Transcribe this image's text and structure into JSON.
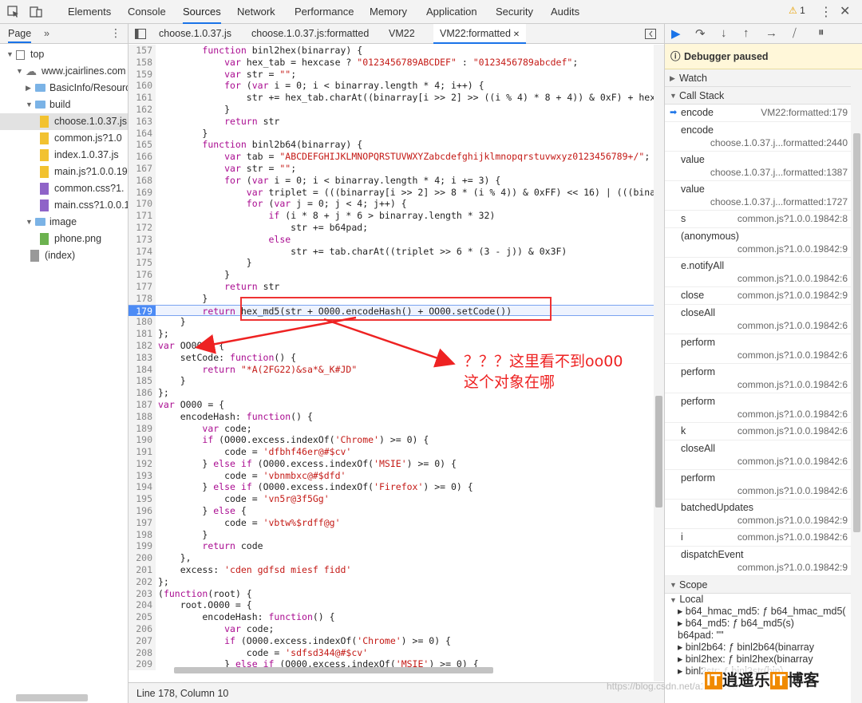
{
  "devtools": {
    "tabs": [
      "Elements",
      "Console",
      "Sources",
      "Network",
      "Performance",
      "Memory",
      "Application",
      "Security",
      "Audits"
    ],
    "active_tab": "Sources",
    "warning_count": "1"
  },
  "navigator": {
    "title": "Page",
    "tree": [
      {
        "label": "top",
        "indent": 0,
        "kind": "frame",
        "open": true
      },
      {
        "label": "www.jcairlines.com",
        "indent": 1,
        "kind": "cloud",
        "open": true
      },
      {
        "label": "BasicInfo/Resourc",
        "indent": 2,
        "kind": "folder",
        "open": false
      },
      {
        "label": "build",
        "indent": 2,
        "kind": "folder",
        "open": true
      },
      {
        "label": "choose.1.0.37.js",
        "indent": 3,
        "kind": "js",
        "selected": true
      },
      {
        "label": "common.js?1.0",
        "indent": 3,
        "kind": "js"
      },
      {
        "label": "index.1.0.37.js",
        "indent": 3,
        "kind": "js"
      },
      {
        "label": "main.js?1.0.0.19",
        "indent": 3,
        "kind": "js"
      },
      {
        "label": "common.css?1.",
        "indent": 3,
        "kind": "css"
      },
      {
        "label": "main.css?1.0.0.1",
        "indent": 3,
        "kind": "css"
      },
      {
        "label": "image",
        "indent": 2,
        "kind": "folder",
        "open": true
      },
      {
        "label": "phone.png",
        "indent": 3,
        "kind": "img"
      },
      {
        "label": "(index)",
        "indent": 2,
        "kind": "doc"
      }
    ]
  },
  "editor": {
    "tabs": [
      {
        "label": "choose.1.0.37.js",
        "active": false
      },
      {
        "label": "choose.1.0.37.js:formatted",
        "active": false
      },
      {
        "label": "VM22",
        "active": false
      },
      {
        "label": "VM22:formatted",
        "active": true
      }
    ],
    "current_line": 179,
    "status": "Line 178, Column 10",
    "lines": [
      {
        "n": 157,
        "t": "        function binl2hex(binarray) {"
      },
      {
        "n": 158,
        "t": "            var hex_tab = hexcase ? \"0123456789ABCDEF\" : \"0123456789abcdef\";"
      },
      {
        "n": 159,
        "t": "            var str = \"\";"
      },
      {
        "n": 160,
        "t": "            for (var i = 0; i < binarray.length * 4; i++) {"
      },
      {
        "n": 161,
        "t": "                str += hex_tab.charAt((binarray[i >> 2] >> ((i % 4) * 8 + 4)) & 0xF) + hex"
      },
      {
        "n": 162,
        "t": "            }"
      },
      {
        "n": 163,
        "t": "            return str"
      },
      {
        "n": 164,
        "t": "        }"
      },
      {
        "n": 165,
        "t": "        function binl2b64(binarray) {"
      },
      {
        "n": 166,
        "t": "            var tab = \"ABCDEFGHIJKLMNOPQRSTUVWXYZabcdefghijklmnopqrstuvwxyz0123456789+/\";"
      },
      {
        "n": 167,
        "t": "            var str = \"\";"
      },
      {
        "n": 168,
        "t": "            for (var i = 0; i < binarray.length * 4; i += 3) {"
      },
      {
        "n": 169,
        "t": "                var triplet = (((binarray[i >> 2] >> 8 * (i % 4)) & 0xFF) << 16) | (((bina"
      },
      {
        "n": 170,
        "t": "                for (var j = 0; j < 4; j++) {"
      },
      {
        "n": 171,
        "t": "                    if (i * 8 + j * 6 > binarray.length * 32)"
      },
      {
        "n": 172,
        "t": "                        str += b64pad;"
      },
      {
        "n": 173,
        "t": "                    else"
      },
      {
        "n": 174,
        "t": "                        str += tab.charAt((triplet >> 6 * (3 - j)) & 0x3F)"
      },
      {
        "n": 175,
        "t": "                }"
      },
      {
        "n": 176,
        "t": "            }"
      },
      {
        "n": 177,
        "t": "            return str"
      },
      {
        "n": 178,
        "t": "        }"
      },
      {
        "n": 179,
        "t": "        return hex_md5(str + O000.encodeHash() + OO00.setCode())"
      },
      {
        "n": 180,
        "t": "    }"
      },
      {
        "n": 181,
        "t": "};"
      },
      {
        "n": 182,
        "t": "var OO00 = {"
      },
      {
        "n": 183,
        "t": "    setCode: function() {"
      },
      {
        "n": 184,
        "t": "        return \"*A(2FG22)&sa*&_K#JD\""
      },
      {
        "n": 185,
        "t": "    }"
      },
      {
        "n": 186,
        "t": "};"
      },
      {
        "n": 187,
        "t": "var O000 = {"
      },
      {
        "n": 188,
        "t": "    encodeHash: function() {"
      },
      {
        "n": 189,
        "t": "        var code;"
      },
      {
        "n": 190,
        "t": "        if (O000.excess.indexOf('Chrome') >= 0) {"
      },
      {
        "n": 191,
        "t": "            code = 'dfbhf46er@#$cv'"
      },
      {
        "n": 192,
        "t": "        } else if (O000.excess.indexOf('MSIE') >= 0) {"
      },
      {
        "n": 193,
        "t": "            code = 'vbnmbxc@#$dfd'"
      },
      {
        "n": 194,
        "t": "        } else if (O000.excess.indexOf('Firefox') >= 0) {"
      },
      {
        "n": 195,
        "t": "            code = 'vn5r@3f5Gg'"
      },
      {
        "n": 196,
        "t": "        } else {"
      },
      {
        "n": 197,
        "t": "            code = 'vbtw%$rdff@g'"
      },
      {
        "n": 198,
        "t": "        }"
      },
      {
        "n": 199,
        "t": "        return code"
      },
      {
        "n": 200,
        "t": "    },"
      },
      {
        "n": 201,
        "t": "    excess: 'cden gdfsd miesf fidd'"
      },
      {
        "n": 202,
        "t": "};"
      },
      {
        "n": 203,
        "t": "(function(root) {"
      },
      {
        "n": 204,
        "t": "    root.O000 = {"
      },
      {
        "n": 205,
        "t": "        encodeHash: function() {"
      },
      {
        "n": 206,
        "t": "            var code;"
      },
      {
        "n": 207,
        "t": "            if (O000.excess.indexOf('Chrome') >= 0) {"
      },
      {
        "n": 208,
        "t": "                code = 'sdfsd344@#$cv'"
      },
      {
        "n": 209,
        "t": "            } else if (O000.excess.indexOf('MSIE') >= 0) {"
      }
    ]
  },
  "annotation": {
    "line1": "？？？这里看不到oo00",
    "line2": "这个对象在哪"
  },
  "debugger": {
    "paused_label": "Debugger paused",
    "watch_label": "Watch",
    "callstack_label": "Call Stack",
    "frames": [
      {
        "name": "encode",
        "loc": "VM22:formatted:179",
        "current": true
      },
      {
        "name": "encode",
        "loc": "choose.1.0.37.j...formatted:2440"
      },
      {
        "name": "value",
        "loc": "choose.1.0.37.j...formatted:1387"
      },
      {
        "name": "value",
        "loc": "choose.1.0.37.j...formatted:1727"
      },
      {
        "name": "s",
        "loc": "common.js?1.0.0.19842:8",
        "one": true
      },
      {
        "name": "(anonymous)",
        "loc": "common.js?1.0.0.19842:9"
      },
      {
        "name": "e.notifyAll",
        "loc": "common.js?1.0.0.19842:6"
      },
      {
        "name": "close",
        "loc": "common.js?1.0.0.19842:9",
        "one": true
      },
      {
        "name": "closeAll",
        "loc": "common.js?1.0.0.19842:6"
      },
      {
        "name": "perform",
        "loc": "common.js?1.0.0.19842:6"
      },
      {
        "name": "perform",
        "loc": "common.js?1.0.0.19842:6"
      },
      {
        "name": "perform",
        "loc": "common.js?1.0.0.19842:6"
      },
      {
        "name": "k",
        "loc": "common.js?1.0.0.19842:6",
        "one": true
      },
      {
        "name": "closeAll",
        "loc": "common.js?1.0.0.19842:6"
      },
      {
        "name": "perform",
        "loc": "common.js?1.0.0.19842:6"
      },
      {
        "name": "batchedUpdates",
        "loc": "common.js?1.0.0.19842:9"
      },
      {
        "name": "i",
        "loc": "common.js?1.0.0.19842:6",
        "one": true
      },
      {
        "name": "dispatchEvent",
        "loc": "common.js?1.0.0.19842:9"
      }
    ],
    "scope_label": "Scope",
    "local_label": "Local",
    "scope_items": [
      "▸ b64_hmac_md5: ƒ b64_hmac_md5(",
      "▸ b64_md5: ƒ b64_md5(s)",
      "  b64pad: \"\"",
      "▸ binl2b64: ƒ binl2b64(binarray",
      "▸ binl2hex: ƒ binl2hex(binarray",
      "▸ binl2str: ƒ binl2str(bin)"
    ]
  },
  "watermark": "https://blog.csdn.net/a1990928",
  "logo": {
    "mark": "IT",
    "text": "逍遥乐",
    "mark2": "IT",
    "text2": "博客"
  }
}
